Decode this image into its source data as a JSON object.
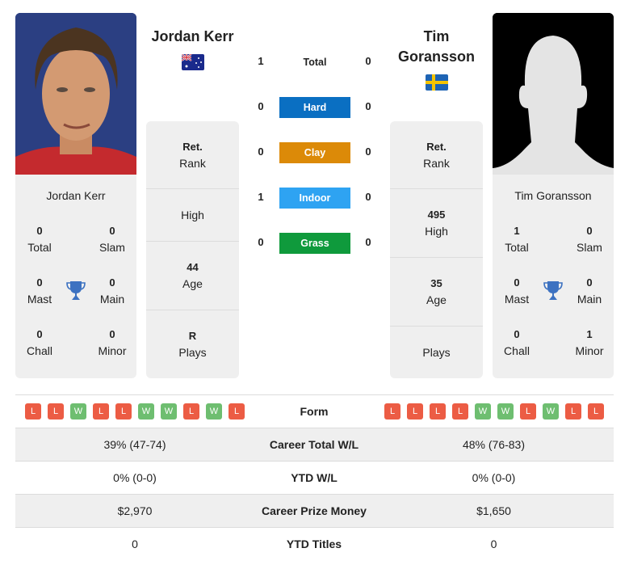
{
  "colors": {
    "hard": "#0a6fc2",
    "clay": "#dc8a08",
    "indoor": "#2ea3f2",
    "grass": "#0f9a3c",
    "win": "#6ebe70",
    "loss": "#ec5c44",
    "trophy": "#3d72c1"
  },
  "player1": {
    "name": "Jordan Kerr",
    "flag": "australia-flag",
    "titles": {
      "total": "0",
      "slam": "0",
      "mast": "0",
      "main": "0",
      "chall": "0",
      "minor": "0"
    },
    "rank": {
      "value": "Ret.",
      "label": "Rank"
    },
    "high": {
      "value": "",
      "label": "High"
    },
    "age": {
      "value": "44",
      "label": "Age"
    },
    "plays": {
      "value": "R",
      "label": "Plays"
    },
    "form": [
      "L",
      "L",
      "W",
      "L",
      "L",
      "W",
      "W",
      "L",
      "W",
      "L"
    ],
    "career_wl": "39% (47-74)",
    "ytd_wl": "0% (0-0)",
    "prize": "$2,970",
    "ytd_titles": "0"
  },
  "player2": {
    "name": "Tim Goransson",
    "flag": "sweden-flag",
    "titles": {
      "total": "1",
      "slam": "0",
      "mast": "0",
      "main": "0",
      "chall": "0",
      "minor": "1"
    },
    "rank": {
      "value": "Ret.",
      "label": "Rank"
    },
    "high": {
      "value": "495",
      "label": "High"
    },
    "age": {
      "value": "35",
      "label": "Age"
    },
    "plays": {
      "value": "",
      "label": "Plays"
    },
    "form": [
      "L",
      "L",
      "L",
      "L",
      "W",
      "W",
      "L",
      "W",
      "L",
      "L"
    ],
    "career_wl": "48% (76-83)",
    "ytd_wl": "0% (0-0)",
    "prize": "$1,650",
    "ytd_titles": "0"
  },
  "labels": {
    "total": "Total",
    "slam": "Slam",
    "mast": "Mast",
    "main": "Main",
    "chall": "Chall",
    "minor": "Minor"
  },
  "h2h": {
    "total": {
      "label": "Total",
      "p1": "1",
      "p2": "0"
    },
    "hard": {
      "label": "Hard",
      "p1": "0",
      "p2": "0"
    },
    "clay": {
      "label": "Clay",
      "p1": "0",
      "p2": "0"
    },
    "indoor": {
      "label": "Indoor",
      "p1": "1",
      "p2": "0"
    },
    "grass": {
      "label": "Grass",
      "p1": "0",
      "p2": "0"
    }
  },
  "rows": {
    "form": "Form",
    "career_wl": "Career Total W/L",
    "ytd_wl": "YTD W/L",
    "prize": "Career Prize Money",
    "ytd_titles": "YTD Titles"
  },
  "name_p2_lines": [
    "Tim",
    "Goransson"
  ]
}
